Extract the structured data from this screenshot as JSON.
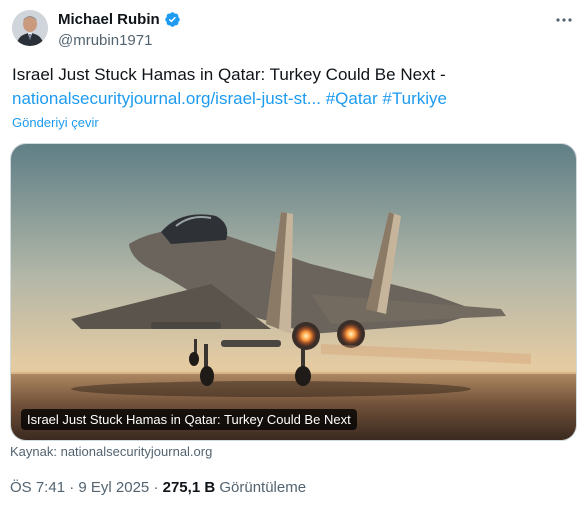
{
  "author": {
    "name": "Michael Rubin",
    "handle": "@mrubin1971"
  },
  "tweet": {
    "text_prefix": "Israel Just Stuck Hamas in Qatar: Turkey Could Be Next - ",
    "link_text": "nationalsecurityjournal.org/israel-just-st...",
    "hashtag1": "#Qatar",
    "hashtag2": "#Turkiye",
    "translate_label": "Gönderiyi çevir"
  },
  "card": {
    "title": "Israel Just Stuck Hamas in Qatar: Turkey Could Be Next",
    "source": "Kaynak: nationalsecurityjournal.org"
  },
  "meta": {
    "time": "ÖS 7:41",
    "date": "9 Eyl 2025",
    "views": "275,1 B",
    "views_label": "Görüntüleme",
    "separator": "·"
  },
  "icons": {
    "verified": "verified-badge-icon",
    "more": "more-options-icon"
  },
  "colors": {
    "link": "#1d9bf0",
    "text": "#0f1419",
    "muted": "#536471"
  }
}
